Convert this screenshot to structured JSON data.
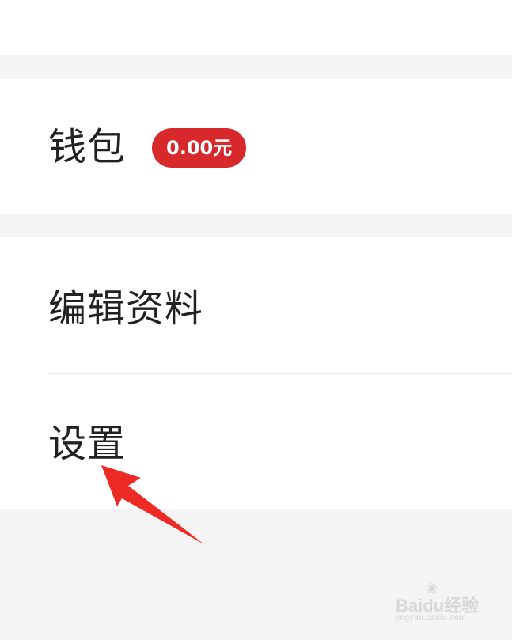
{
  "wallet": {
    "label": "钱包",
    "balance_badge": "0.00元"
  },
  "menu": {
    "edit_profile_label": "编辑资料",
    "settings_label": "设置"
  },
  "watermark": {
    "brand": "Baidu经验",
    "sub": "jingyan.baidu.com"
  },
  "colors": {
    "badge_red": "#d7282b",
    "arrow_red": "#ee2a24",
    "page_background": "#f4f4f4",
    "card_background": "#ffffff",
    "text_primary": "#222222"
  },
  "icons": {
    "annotation": "arrow-pointer-icon",
    "watermark_logo": "baidu-paw-icon"
  }
}
